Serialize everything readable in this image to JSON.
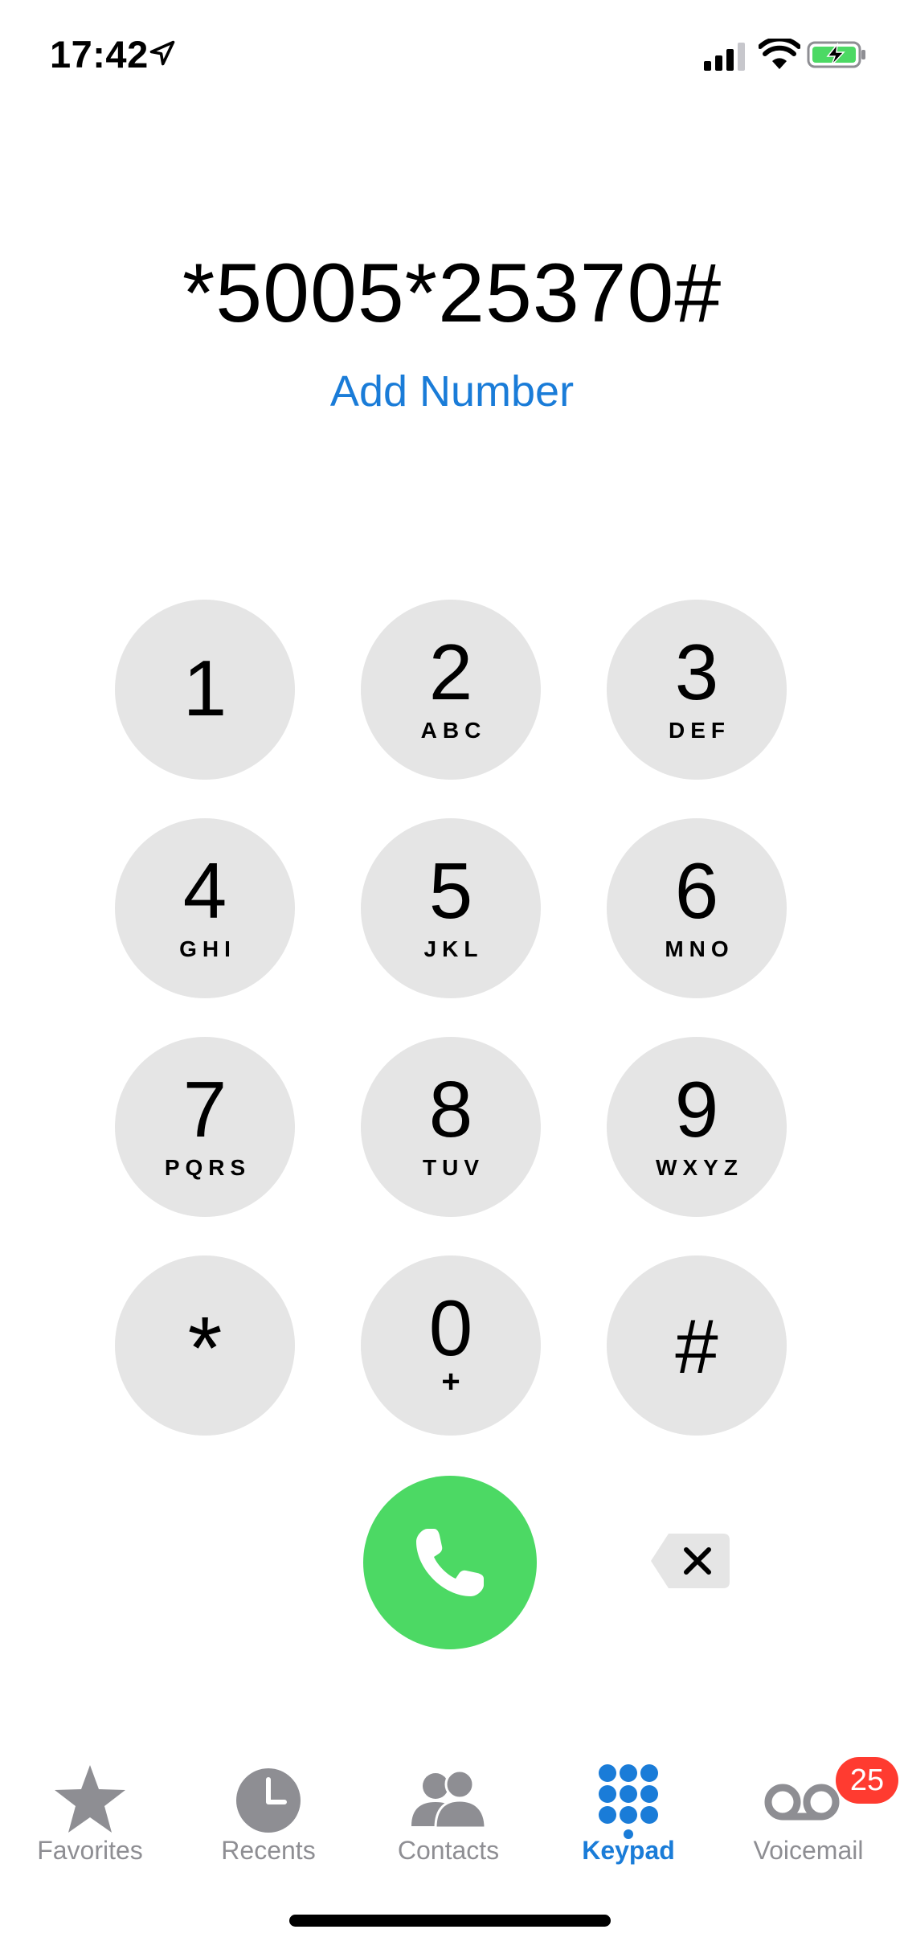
{
  "status_bar": {
    "time": "17:42",
    "icons": [
      "location-arrow-icon",
      "cellular-signal-icon",
      "wifi-icon",
      "battery-charging-icon"
    ]
  },
  "dialer": {
    "number": "*5005*25370#",
    "add_number_label": "Add Number"
  },
  "keypad": {
    "keys": [
      {
        "digit": "1",
        "letters": ""
      },
      {
        "digit": "2",
        "letters": "ABC"
      },
      {
        "digit": "3",
        "letters": "DEF"
      },
      {
        "digit": "4",
        "letters": "GHI"
      },
      {
        "digit": "5",
        "letters": "JKL"
      },
      {
        "digit": "6",
        "letters": "MNO"
      },
      {
        "digit": "7",
        "letters": "PQRS"
      },
      {
        "digit": "8",
        "letters": "TUV"
      },
      {
        "digit": "9",
        "letters": "WXYZ"
      },
      {
        "digit": "*",
        "letters": ""
      },
      {
        "digit": "0",
        "letters": "+"
      },
      {
        "digit": "#",
        "letters": ""
      }
    ],
    "call_icon": "phone-icon",
    "delete_icon": "delete-backspace-icon"
  },
  "tab_bar": {
    "tabs": [
      {
        "label": "Favorites",
        "icon": "star-icon"
      },
      {
        "label": "Recents",
        "icon": "clock-icon"
      },
      {
        "label": "Contacts",
        "icon": "contacts-icon"
      },
      {
        "label": "Keypad",
        "icon": "keypad-icon"
      },
      {
        "label": "Voicemail",
        "icon": "voicemail-icon"
      }
    ],
    "active_tab": "Keypad",
    "voicemail_badge": "25"
  },
  "colors": {
    "accent": "#1a7cd8",
    "key_background": "#e5e5e5",
    "call_green": "#4cd964",
    "badge_red": "#ff3b30",
    "inactive_gray": "#8e8e93"
  }
}
